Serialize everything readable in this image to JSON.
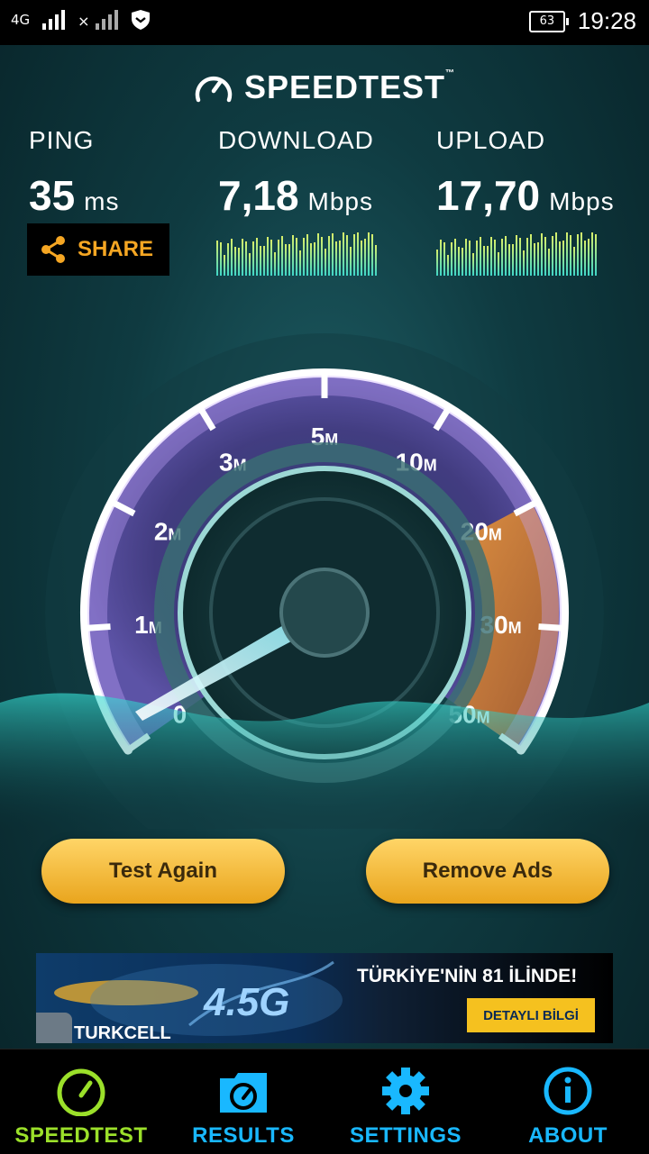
{
  "status_bar": {
    "network_1": "4G",
    "time": "19:28",
    "battery": "63"
  },
  "header": {
    "title": "SPEEDTEST",
    "trademark": "™"
  },
  "ping": {
    "label": "PING",
    "value": "35",
    "unit": "ms"
  },
  "download": {
    "label": "DOWNLOAD",
    "value": "7,18",
    "unit": "Mbps"
  },
  "upload": {
    "label": "UPLOAD",
    "value": "17,70",
    "unit": "Mbps"
  },
  "share": {
    "label": "SHARE"
  },
  "gauge": {
    "tick_labels": [
      {
        "num": "0",
        "suffix": ""
      },
      {
        "num": "1",
        "suffix": "M"
      },
      {
        "num": "2",
        "suffix": "M"
      },
      {
        "num": "3",
        "suffix": "M"
      },
      {
        "num": "5",
        "suffix": "M"
      },
      {
        "num": "10",
        "suffix": "M"
      },
      {
        "num": "20",
        "suffix": "M"
      },
      {
        "num": "30",
        "suffix": "M"
      },
      {
        "num": "50",
        "suffix": "M"
      }
    ]
  },
  "buttons": {
    "test_again": "Test Again",
    "remove_ads": "Remove Ads"
  },
  "ad": {
    "headline": "TÜRKİYE'NİN 81 İLİNDE!",
    "cta": "DETAYLI BİLGİ",
    "network": "4.5G",
    "brand": "TURKCELL"
  },
  "nav": {
    "items": [
      {
        "label": "SPEEDTEST",
        "active": true
      },
      {
        "label": "RESULTS",
        "active": false
      },
      {
        "label": "SETTINGS",
        "active": false
      },
      {
        "label": "ABOUT",
        "active": false
      }
    ]
  },
  "colors": {
    "accent_orange": "#f5a623",
    "nav_active": "#9be02a",
    "nav_inactive": "#19b8ff",
    "button_gold": "#f2b93b"
  }
}
